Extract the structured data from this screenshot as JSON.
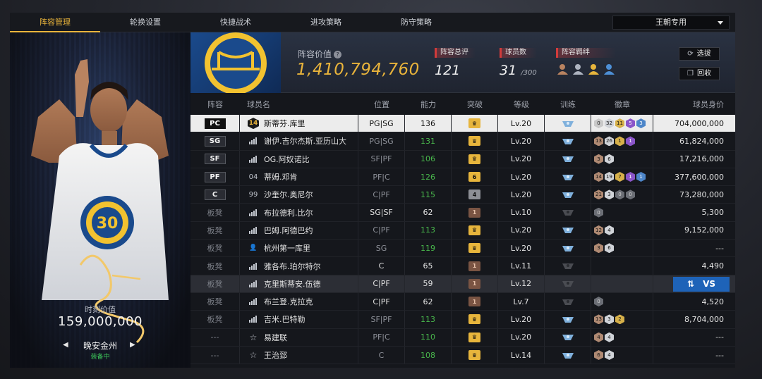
{
  "tabs": [
    "阵容管理",
    "轮换设置",
    "快捷战术",
    "进攻策略",
    "防守策略"
  ],
  "dynasty_select": "王朝专用",
  "card": {
    "number": "30",
    "moment_label": "时刻价值",
    "moment_value": "159,000,000",
    "name": "晚安金州",
    "status": "装备中"
  },
  "summary": {
    "lineup_value_label": "阵容价值",
    "lineup_value": "1,410,794,760",
    "overall_label": "阵容总评",
    "overall_value": "121",
    "players_label": "球员数",
    "players_value": "31",
    "players_max": "/300",
    "bond_label": "阵容羁绊",
    "select_btn": "选拔",
    "recycle_btn": "回收"
  },
  "columns": [
    "阵容",
    "球员名",
    "位置",
    "能力",
    "突破",
    "等级",
    "训练",
    "徽章",
    "球员身价"
  ],
  "rows": [
    {
      "pos": "PC",
      "starter": true,
      "icon": "14",
      "name": "斯蒂芬.库里",
      "role": "PG|SG",
      "ability": "136",
      "ability_green": false,
      "breakthrough": "",
      "brk_style": "gold",
      "level": "Lv.20",
      "badges": [
        "0",
        "32",
        "11",
        "5",
        "3"
      ],
      "value": "704,000,000"
    },
    {
      "pos": "SG",
      "starter": true,
      "icon": "bars",
      "name": "谢伊.吉尔杰斯.亚历山大",
      "role": "PG|SG",
      "ability": "131",
      "ability_green": true,
      "breakthrough": "",
      "brk_style": "gold",
      "level": "Lv.20",
      "badges": [
        "13",
        "26",
        "1",
        "1"
      ],
      "value": "61,824,000"
    },
    {
      "pos": "SF",
      "starter": true,
      "icon": "bars",
      "name": "OG.阿奴诺比",
      "role": "SF|PF",
      "ability": "106",
      "ability_green": true,
      "breakthrough": "",
      "brk_style": "gold",
      "level": "Lv.20",
      "badges": [
        "3",
        "6"
      ],
      "value": "17,216,000"
    },
    {
      "pos": "PF",
      "starter": true,
      "icon": "04",
      "name": "蒂姆.邓肯",
      "role": "PF|C",
      "ability": "126",
      "ability_green": true,
      "breakthrough": "6",
      "brk_style": "gold",
      "level": "Lv.20",
      "badges": [
        "14",
        "19",
        "7",
        "1",
        "1"
      ],
      "value": "377,600,000"
    },
    {
      "pos": "C",
      "starter": true,
      "icon": "99",
      "name": "沙奎尔.奥尼尔",
      "role": "C|PF",
      "ability": "115",
      "ability_green": true,
      "breakthrough": "4",
      "brk_style": "gray",
      "level": "Lv.20",
      "badges": [
        "21",
        "3",
        "0",
        "0"
      ],
      "value": "73,280,000"
    },
    {
      "pos": "板凳",
      "starter": false,
      "icon": "bars",
      "name": "布拉德利.比尔",
      "role": "SG|SF",
      "ability": "62",
      "ability_green": false,
      "breakthrough": "1",
      "brk_style": "bronze",
      "level": "Lv.10",
      "badges": [
        "0"
      ],
      "value": "5,300"
    },
    {
      "pos": "板凳",
      "starter": false,
      "icon": "bars",
      "name": "巴姆.阿德巴约",
      "role": "C|PF",
      "ability": "113",
      "ability_green": true,
      "breakthrough": "",
      "brk_style": "gold",
      "level": "Lv.20",
      "badges": [
        "12",
        "4"
      ],
      "value": "9,152,000"
    },
    {
      "pos": "板凳",
      "starter": false,
      "icon": "user",
      "name": "杭州第一库里",
      "role": "SG",
      "ability": "119",
      "ability_green": true,
      "breakthrough": "",
      "brk_style": "gold",
      "level": "Lv.20",
      "badges": [
        "3",
        "6"
      ],
      "value": "---"
    },
    {
      "pos": "板凳",
      "starter": false,
      "icon": "bars",
      "name": "雅各布.珀尔特尔",
      "role": "C",
      "ability": "65",
      "ability_green": false,
      "breakthrough": "1",
      "brk_style": "bronze",
      "level": "Lv.11",
      "badges": [],
      "value": "4,490"
    },
    {
      "pos": "板凳",
      "starter": false,
      "icon": "bars",
      "name": "克里斯蒂安.伍德",
      "role": "C|PF",
      "ability": "59",
      "ability_green": false,
      "breakthrough": "1",
      "brk_style": "bronze",
      "level": "Lv.12",
      "badges": [],
      "value": "VS"
    },
    {
      "pos": "板凳",
      "starter": false,
      "icon": "bars",
      "name": "布兰登.克拉克",
      "role": "C|PF",
      "ability": "62",
      "ability_green": false,
      "breakthrough": "1",
      "brk_style": "bronze",
      "level": "Lv.7",
      "badges": [
        "0"
      ],
      "value": "4,520"
    },
    {
      "pos": "板凳",
      "starter": false,
      "icon": "bars",
      "name": "吉米.巴特勒",
      "role": "SF|PF",
      "ability": "113",
      "ability_green": true,
      "breakthrough": "",
      "brk_style": "gold",
      "level": "Lv.20",
      "badges": [
        "13",
        "3",
        "2"
      ],
      "value": "8,704,000"
    },
    {
      "pos": "---",
      "starter": false,
      "icon": "star",
      "name": "易建联",
      "role": "PF|C",
      "ability": "110",
      "ability_green": true,
      "breakthrough": "",
      "brk_style": "gold",
      "level": "Lv.20",
      "badges": [
        "4",
        "4"
      ],
      "value": "---"
    },
    {
      "pos": "---",
      "starter": false,
      "icon": "star",
      "name": "王治郅",
      "role": "C",
      "ability": "108",
      "ability_green": true,
      "breakthrough": "",
      "brk_style": "gold",
      "level": "Lv.14",
      "badges": [
        "6",
        "4"
      ],
      "value": "---"
    }
  ]
}
